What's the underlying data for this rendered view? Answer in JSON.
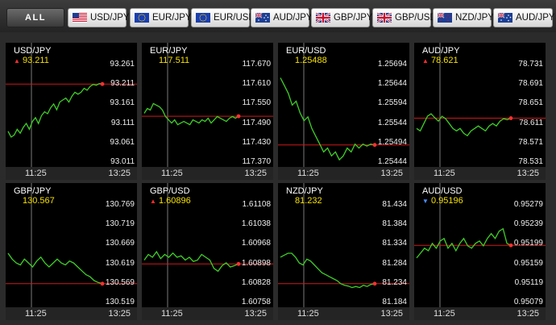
{
  "tabs": {
    "all_label": "ALL",
    "pairs": [
      {
        "label": "USD/JPY",
        "flag": "us-flag-icon"
      },
      {
        "label": "EUR/JPY",
        "flag": "eu-flag-icon"
      },
      {
        "label": "EUR/USD",
        "flag": "eu-flag-icon"
      },
      {
        "label": "AUD/JPY",
        "flag": "au-flag-icon"
      },
      {
        "label": "GBP/JPY",
        "flag": "uk-flag-icon"
      },
      {
        "label": "GBP/USD",
        "flag": "uk-flag-icon"
      },
      {
        "label": "NZD/JPY",
        "flag": "nz-flag-icon"
      },
      {
        "label": "AUD/JPY",
        "flag": "au-flag-icon"
      }
    ]
  },
  "colors": {
    "price": "#f5e000",
    "line": "#3ecf27",
    "last_line": "#d01818",
    "up_arrow": "#ff2b2b",
    "down_arrow": "#4a8cff",
    "panel_bg": "#000000"
  },
  "panels": [
    {
      "pair": "USD/JPY",
      "price": "93.211",
      "direction": "up",
      "ticks": [
        "93.261",
        "93.211",
        "93.161",
        "93.111",
        "93.061",
        "93.011"
      ],
      "time_start": "11:25",
      "time_end": "13:25",
      "series": [
        93.09,
        93.075,
        93.08,
        93.095,
        93.085,
        93.1,
        93.11,
        93.095,
        93.115,
        93.125,
        93.11,
        93.13,
        93.14,
        93.135,
        93.15,
        93.16,
        93.145,
        93.165,
        93.17,
        93.175,
        93.165,
        93.18,
        93.19,
        93.185,
        93.19,
        93.2,
        93.195,
        93.205,
        93.21,
        93.208,
        93.212,
        93.211
      ]
    },
    {
      "pair": "EUR/JPY",
      "price": "117.511",
      "direction": "none",
      "ticks": [
        "117.670",
        "117.610",
        "117.550",
        "117.490",
        "117.430",
        "117.370"
      ],
      "time_start": "11:25",
      "time_end": "13:25",
      "series": [
        117.52,
        117.535,
        117.53,
        117.55,
        117.545,
        117.54,
        117.53,
        117.51,
        117.5,
        117.49,
        117.5,
        117.485,
        117.49,
        117.495,
        117.49,
        117.485,
        117.5,
        117.495,
        117.49,
        117.5,
        117.495,
        117.505,
        117.49,
        117.5,
        117.51,
        117.505,
        117.5,
        117.495,
        117.505,
        117.51,
        117.505,
        117.511
      ]
    },
    {
      "pair": "EUR/USD",
      "price": "1.25488",
      "direction": "none",
      "ticks": [
        "1.25694",
        "1.25644",
        "1.25594",
        "1.25544",
        "1.25494",
        "1.25444"
      ],
      "time_start": "11:25",
      "time_end": "13:25",
      "series": [
        1.2566,
        1.2564,
        1.2562,
        1.2559,
        1.256,
        1.2557,
        1.2555,
        1.2556,
        1.2553,
        1.2551,
        1.2549,
        1.2547,
        1.2548,
        1.2546,
        1.2547,
        1.2545,
        1.2546,
        1.2548,
        1.2547,
        1.2549,
        1.2548,
        1.2549,
        1.25485,
        1.2549,
        1.25488
      ]
    },
    {
      "pair": "AUD/JPY",
      "price": "78.621",
      "direction": "up",
      "ticks": [
        "78.731",
        "78.691",
        "78.651",
        "78.611",
        "78.571",
        "78.531"
      ],
      "time_start": "11:25",
      "time_end": "13:25",
      "series": [
        78.6,
        78.595,
        78.61,
        78.625,
        78.63,
        78.622,
        78.615,
        78.625,
        78.62,
        78.61,
        78.6,
        78.595,
        78.6,
        78.59,
        78.585,
        78.595,
        78.6,
        78.605,
        78.6,
        78.595,
        78.605,
        78.61,
        78.605,
        78.615,
        78.62,
        78.618,
        78.621
      ]
    },
    {
      "pair": "GBP/JPY",
      "price": "130.567",
      "direction": "none",
      "ticks": [
        "130.769",
        "130.719",
        "130.669",
        "130.619",
        "130.569",
        "130.519"
      ],
      "time_start": "11:25",
      "time_end": "13:25",
      "series": [
        130.645,
        130.63,
        130.62,
        130.615,
        130.63,
        130.62,
        130.61,
        130.625,
        130.635,
        130.62,
        130.61,
        130.62,
        130.63,
        130.62,
        130.615,
        130.625,
        130.62,
        130.61,
        130.6,
        130.59,
        130.585,
        130.575,
        130.57,
        130.567
      ]
    },
    {
      "pair": "GBP/USD",
      "price": "1.60896",
      "direction": "up",
      "ticks": [
        "1.61108",
        "1.61038",
        "1.60968",
        "1.60898",
        "1.60828",
        "1.60758"
      ],
      "time_start": "11:25",
      "time_end": "13:25",
      "series": [
        1.6091,
        1.6093,
        1.6092,
        1.6094,
        1.60915,
        1.6093,
        1.6092,
        1.60935,
        1.6092,
        1.60925,
        1.6091,
        1.6092,
        1.60905,
        1.6091,
        1.6093,
        1.6092,
        1.6091,
        1.6088,
        1.6087,
        1.6089,
        1.609,
        1.60885,
        1.6089,
        1.60896
      ]
    },
    {
      "pair": "NZD/JPY",
      "price": "81.232",
      "direction": "none",
      "ticks": [
        "81.434",
        "81.384",
        "81.334",
        "81.284",
        "81.234",
        "81.184"
      ],
      "time_start": "11:25",
      "time_end": "13:25",
      "series": [
        81.3,
        81.305,
        81.31,
        81.31,
        81.3,
        81.285,
        81.28,
        81.295,
        81.29,
        81.28,
        81.27,
        81.26,
        81.255,
        81.25,
        81.245,
        81.24,
        81.232,
        81.228,
        81.226,
        81.222,
        81.225,
        81.222,
        81.228,
        81.225,
        81.23,
        81.232
      ]
    },
    {
      "pair": "AUD/USD",
      "price": "0.95196",
      "direction": "down",
      "ticks": [
        "0.95279",
        "0.95239",
        "0.95199",
        "0.95159",
        "0.95119",
        "0.95079"
      ],
      "time_start": "11:25",
      "time_end": "13:25",
      "series": [
        0.9517,
        0.9518,
        0.9519,
        0.95185,
        0.952,
        0.9519,
        0.95205,
        0.9521,
        0.9519,
        0.952,
        0.95185,
        0.952,
        0.9521,
        0.95195,
        0.9519,
        0.952,
        0.95205,
        0.95195,
        0.9521,
        0.9522,
        0.9521,
        0.95225,
        0.9523,
        0.952,
        0.95196
      ]
    }
  ]
}
